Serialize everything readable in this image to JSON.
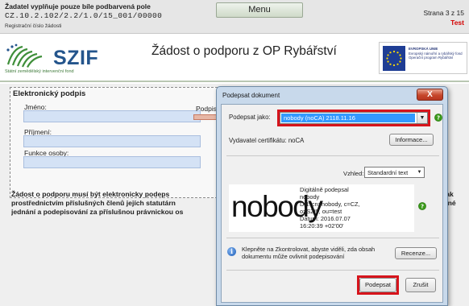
{
  "header": {
    "notice": "Žadatel vyplňuje pouze bíle podbarvená pole",
    "form_code": "CZ.10.2.102/2.2/1.0/15_001/00000",
    "reg_label": "Registrační číslo žádosti",
    "menu_label": "Menu",
    "page_label": "Strana 3 z 15",
    "env_label": "Test"
  },
  "logo": {
    "name": "SZIF",
    "subtitle": "Státní zemědělský intervenční fond"
  },
  "page_title": "Žádost o podporu z OP Rybářství",
  "eu_badge": {
    "lines": [
      "EVROPSKÁ UNIE",
      "Evropský námořní a rybářský fond",
      "Operační program Rybářství"
    ]
  },
  "form": {
    "section_title": "Elektronický podpis",
    "fields": [
      {
        "label": "Jméno:",
        "value": ""
      },
      {
        "label": "Příjmení:",
        "value": ""
      },
      {
        "label": "Funkce osoby:",
        "value": ""
      }
    ],
    "signature_label": "Podpis",
    "paragraph_lines": [
      "Žádost o podporu musí být elektronicky podeps",
      "prostřednictvím příslušných členů jejích statutárn",
      "jednání a podepisování za příslušnou právnickou os"
    ],
    "paragraph_right_lines": [
      "pak",
      "atné"
    ]
  },
  "dialog": {
    "title": "Podepsat dokument",
    "close_label": "X",
    "sign_as_label": "Podepsat jako:",
    "sign_as_value": "nobody (noCA) 2118.11.16",
    "issuer_label": "Vydavatel certifikátu: noCA",
    "info_button": "Informace...",
    "look_label": "Vzhled:",
    "look_value": "Standardní text",
    "preview_name": "nobody",
    "preview_lines": [
      "Digitálně podepsal",
      "nobody",
      "DN: cn=nobody, c=CZ,",
      "o=SZIF, ou=test",
      "Datum: 2016.07.07",
      "16:20:39 +02'00'"
    ],
    "notice_text": "Klepněte na Zkontrolovat, abyste viděli, zda obsah dokumentu může ovlivnit podepisování",
    "review_button": "Recenze...",
    "sign_button": "Podepsat",
    "cancel_button": "Zrušit"
  },
  "colors": {
    "accent_red": "#d6141c",
    "field_blue": "#d4e2f5",
    "selection_blue": "#3399ff",
    "szif_blue": "#24558c",
    "help_green": "#3a9a1a"
  }
}
